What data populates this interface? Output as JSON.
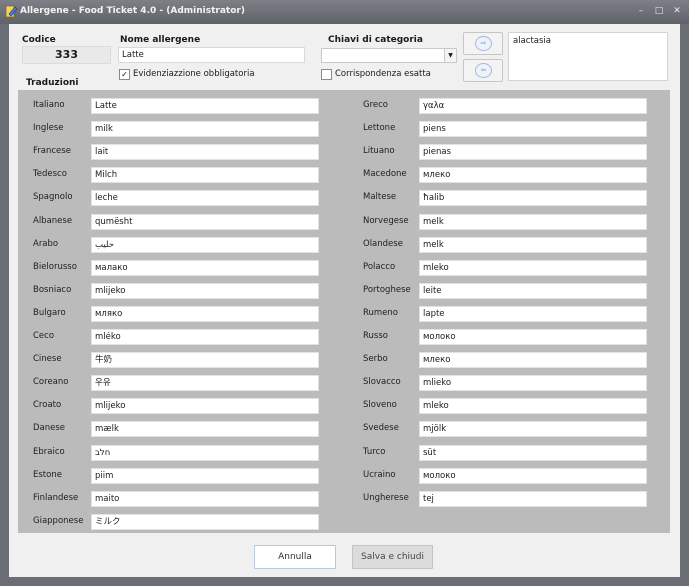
{
  "window": {
    "title": "Allergene - Food Ticket 4.0 - (Administrator)",
    "controls": {
      "minimize": "–",
      "maximize": "□",
      "close": "✕"
    }
  },
  "header": {
    "codice_label": "Codice",
    "codice_value": "333",
    "nome_label": "Nome allergene",
    "nome_value": "Latte",
    "evidenziazione_label": "Evidenziazzione obbligatoria",
    "evidenziazione_checked": true,
    "chiavi_label": "Chiavi di categoria",
    "chiavi_value": "",
    "corrispondenza_label": "Corrispondenza esatta",
    "corrispondenza_checked": false,
    "add_key_icon": "arrow-right-icon",
    "remove_key_icon": "arrow-left-icon",
    "keys_list": [
      "alactasia"
    ]
  },
  "traduzioni_label": "Traduzioni",
  "translations_left": [
    {
      "language": "Italiano",
      "value": "Latte"
    },
    {
      "language": "Inglese",
      "value": "milk"
    },
    {
      "language": "Francese",
      "value": "lait"
    },
    {
      "language": "Tedesco",
      "value": "Milch"
    },
    {
      "language": "Spagnolo",
      "value": "leche"
    },
    {
      "language": "Albanese",
      "value": "qumësht"
    },
    {
      "language": "Arabo",
      "value": "حليب"
    },
    {
      "language": "Bielorusso",
      "value": "малако"
    },
    {
      "language": "Bosniaco",
      "value": "mlijeko"
    },
    {
      "language": "Bulgaro",
      "value": "мляко"
    },
    {
      "language": "Ceco",
      "value": "mléko"
    },
    {
      "language": "Cinese",
      "value": "牛奶"
    },
    {
      "language": "Coreano",
      "value": "우유"
    },
    {
      "language": "Croato",
      "value": "mlijeko"
    },
    {
      "language": "Danese",
      "value": "mælk"
    },
    {
      "language": "Ebraico",
      "value": "חלב"
    },
    {
      "language": "Estone",
      "value": "piim"
    },
    {
      "language": "Finlandese",
      "value": "maito"
    },
    {
      "language": "Giapponese",
      "value": "ミルク"
    }
  ],
  "translations_right": [
    {
      "language": "Greco",
      "value": "γαλα"
    },
    {
      "language": "Lettone",
      "value": "piens"
    },
    {
      "language": "Lituano",
      "value": "pienas"
    },
    {
      "language": "Macedone",
      "value": "млеко"
    },
    {
      "language": "Maltese",
      "value": "ħalib"
    },
    {
      "language": "Norvegese",
      "value": "melk"
    },
    {
      "language": "Olandese",
      "value": "melk"
    },
    {
      "language": "Polacco",
      "value": "mleko"
    },
    {
      "language": "Portoghese",
      "value": "leite"
    },
    {
      "language": "Rumeno",
      "value": "lapte"
    },
    {
      "language": "Russo",
      "value": "молоко"
    },
    {
      "language": "Serbo",
      "value": "млеко"
    },
    {
      "language": "Slovacco",
      "value": "mlieko"
    },
    {
      "language": "Sloveno",
      "value": "mleko"
    },
    {
      "language": "Svedese",
      "value": "mjölk"
    },
    {
      "language": "Turco",
      "value": "süt"
    },
    {
      "language": "Ucraino",
      "value": "молоко"
    },
    {
      "language": "Ungherese",
      "value": "tej"
    }
  ],
  "footer": {
    "annulla_label": "Annulla",
    "salva_label": "Salva e chiudi"
  }
}
